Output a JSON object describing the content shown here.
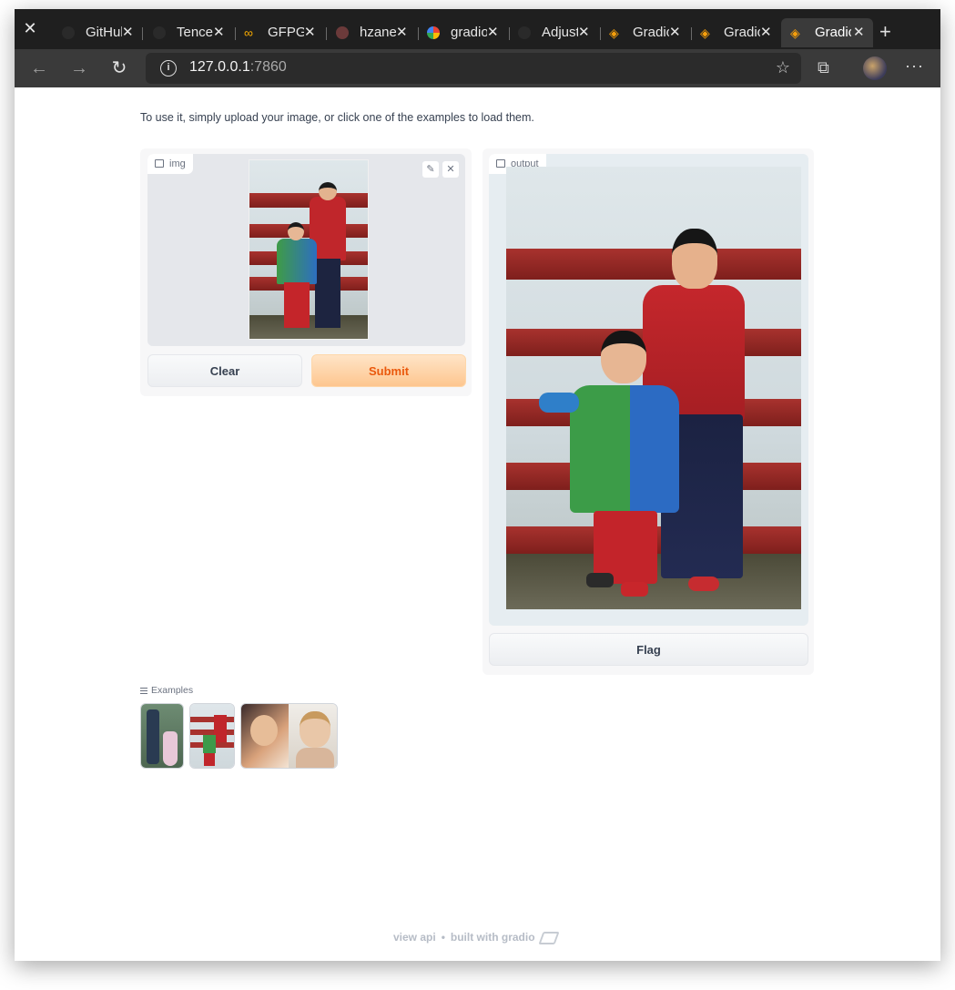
{
  "browser": {
    "tabs": [
      {
        "label": "GitHub",
        "icon": "github-icon",
        "close": "✕"
      },
      {
        "label": "Tencent",
        "icon": "github-icon",
        "close": "✕"
      },
      {
        "label": "GFPGAN",
        "icon": "colab-icon",
        "close": "✕"
      },
      {
        "label": "hzane",
        "icon": "git-icon",
        "close": "✕"
      },
      {
        "label": "gradio",
        "icon": "google-icon",
        "close": "✕"
      },
      {
        "label": "Adjust",
        "icon": "github-icon",
        "close": "✕"
      },
      {
        "label": "Gradio",
        "icon": "gradio-icon",
        "close": "✕"
      },
      {
        "label": "Gradio",
        "icon": "gradio-icon",
        "close": "✕"
      },
      {
        "label": "Gradio",
        "icon": "gradio-icon",
        "close": "✕",
        "active": true
      }
    ],
    "new_tab": "+",
    "close_window": "✕",
    "nav": {
      "back": "←",
      "forward": "→",
      "reload": "↻"
    },
    "address": {
      "host": "127.0.0.1",
      "port": ":7860",
      "info": "i"
    },
    "favorites": "☆",
    "extensions": "⧉",
    "more": "···"
  },
  "app": {
    "description": "To use it, simply upload your image, or click one of the examples to load them.",
    "input_label": "img",
    "output_label": "output",
    "edit_icon": "✎",
    "remove_icon": "✕",
    "clear_button": "Clear",
    "submit_button": "Submit",
    "flag_button": "Flag",
    "examples_title": "Examples",
    "footer": {
      "api": "view api",
      "dot": "•",
      "built": "built with gradio"
    }
  },
  "colors": {
    "primary_text": "#ea580c",
    "rail_red": "#a8322e",
    "tab_bg": "#1f1f1f"
  }
}
